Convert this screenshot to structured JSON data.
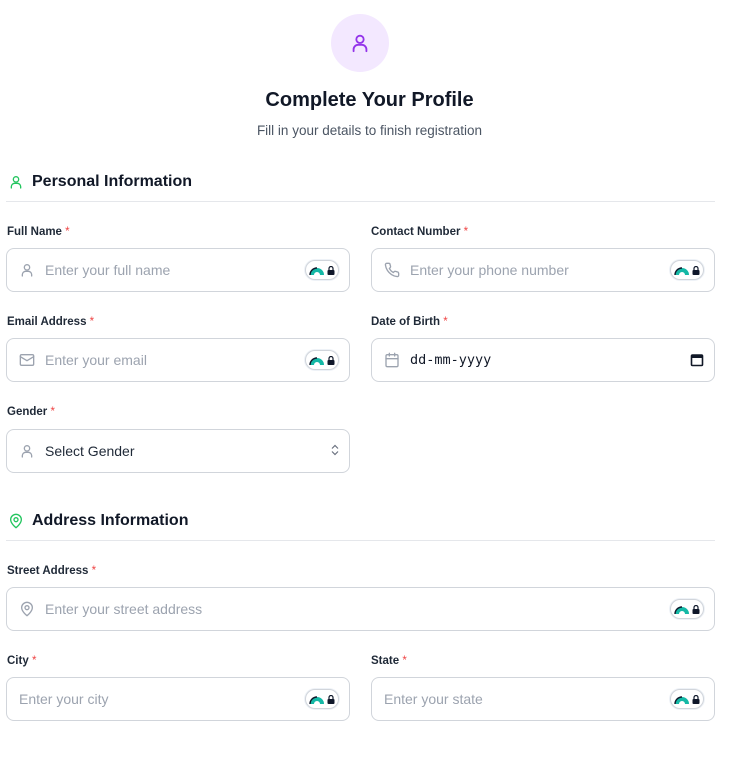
{
  "header": {
    "title": "Complete Your Profile",
    "subtitle": "Fill in your details to finish registration"
  },
  "sections": {
    "personal": {
      "title": "Personal Information"
    },
    "address": {
      "title": "Address Information"
    }
  },
  "fields": {
    "full_name": {
      "label": "Full Name",
      "required": "*",
      "placeholder": "Enter your full name",
      "icon": "user-icon"
    },
    "contact_number": {
      "label": "Contact Number",
      "required": "*",
      "placeholder": "Enter your phone number",
      "icon": "phone-icon"
    },
    "email": {
      "label": "Email Address",
      "required": "*",
      "placeholder": "Enter your email",
      "icon": "mail-icon"
    },
    "dob": {
      "label": "Date of Birth",
      "required": "*",
      "value": "dd-mm-yyyy",
      "icon": "calendar-icon"
    },
    "gender": {
      "label": "Gender",
      "required": "*",
      "selected": "Select Gender",
      "icon": "user-icon"
    },
    "street": {
      "label": "Street Address",
      "required": "*",
      "placeholder": "Enter your street address",
      "icon": "map-pin-icon"
    },
    "city": {
      "label": "City",
      "required": "*",
      "placeholder": "Enter your city"
    },
    "state": {
      "label": "State",
      "required": "*",
      "placeholder": "Enter your state"
    }
  },
  "colors": {
    "accent_purple": "#9333ea",
    "avatar_bg": "#f3e8ff",
    "section_icon_green": "#22c55e",
    "required_red": "#ef4444",
    "badge_teal": "#14b8a6"
  }
}
